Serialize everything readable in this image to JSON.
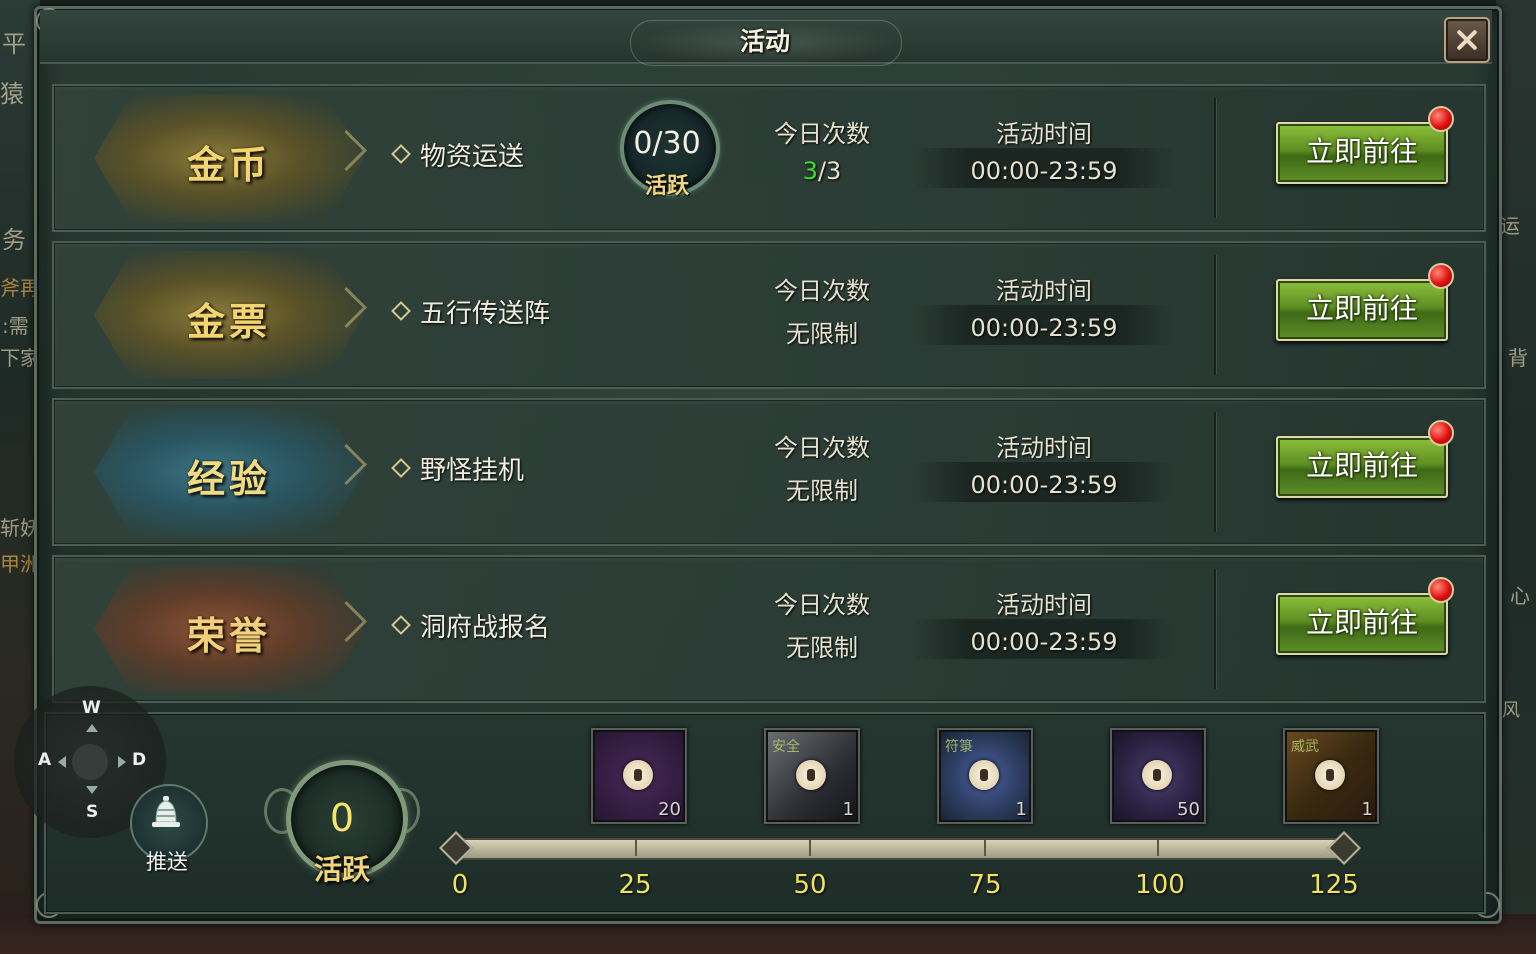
{
  "window": {
    "title": "活动"
  },
  "activities": [
    {
      "category": "金币",
      "name": "物资运送",
      "active": {
        "value": "0/30",
        "label": "活跃"
      },
      "count_header": "今日次数",
      "count_used": "3",
      "count_total": "/3",
      "time_header": "活动时间",
      "time": "00:00-23:59",
      "button": "立即前往"
    },
    {
      "category": "金票",
      "name": "五行传送阵",
      "count_header": "今日次数",
      "count": "无限制",
      "time_header": "活动时间",
      "time": "00:00-23:59",
      "button": "立即前往"
    },
    {
      "category": "经验",
      "name": "野怪挂机",
      "count_header": "今日次数",
      "count": "无限制",
      "time_header": "活动时间",
      "time": "00:00-23:59",
      "button": "立即前往"
    },
    {
      "category": "荣誉",
      "name": "洞府战报名",
      "count_header": "今日次数",
      "count": "无限制",
      "time_header": "活动时间",
      "time": "00:00-23:59",
      "button": "立即前往"
    }
  ],
  "bottom": {
    "dpad": {
      "up": "W",
      "left": "A",
      "right": "D",
      "down": "S"
    },
    "push_label": "推送",
    "activity_points": {
      "value": "0",
      "label": "活跃"
    },
    "rewards": [
      {
        "count": "20",
        "tag": ""
      },
      {
        "count": "1",
        "tag": "安全"
      },
      {
        "count": "1",
        "tag": "符箓"
      },
      {
        "count": "50",
        "tag": ""
      },
      {
        "count": "1",
        "tag": "威武"
      }
    ],
    "milestones": [
      "0",
      "25",
      "50",
      "75",
      "100",
      "125"
    ],
    "progress": 0
  },
  "background_text": {
    "t1": "平",
    "t2": "猿",
    "t3": "务",
    "t4": "斧再",
    "t5": ":需",
    "t6": "下家",
    "t7": "斩妖",
    "t8": "甲洲",
    "r1": "运",
    "r2": "背",
    "r3": "心",
    "r4": "风"
  }
}
